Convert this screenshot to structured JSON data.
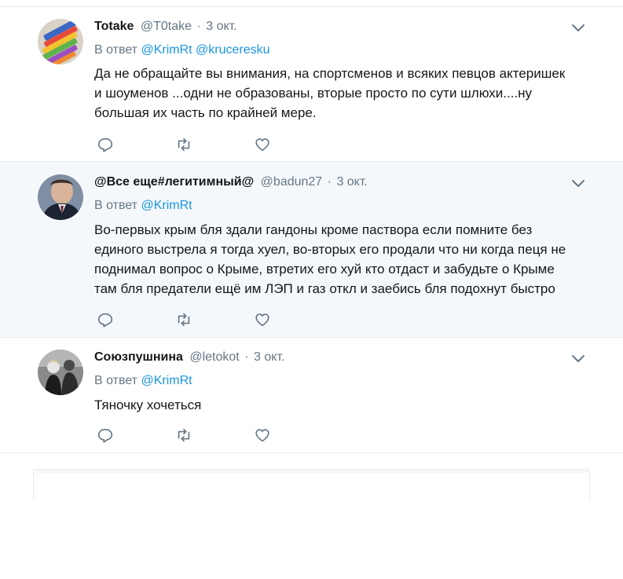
{
  "colors": {
    "link": "#1b95e0",
    "muted": "#657786",
    "text": "#14171a",
    "highlight_bg": "#f5f8fa",
    "divider": "#e6ecf0"
  },
  "tweets": [
    {
      "name": "Totake",
      "handle": "@T0take",
      "separator": "·",
      "date": "3 окт.",
      "reply_prefix": "В ответ",
      "mentions": [
        "@KrimRt",
        "@kruceresku"
      ],
      "text_lines": [
        "Да не обращайте вы внимания, на спортсменов и всяких певцов актеришек",
        "и шоуменов ...одни не образованы, вторые просто по сути шлюхи....ну",
        "большая их часть по крайней мере."
      ],
      "avatar_icon": "colored-pencils-avatar"
    },
    {
      "name": "@Все еще#легитимный@",
      "handle": "@badun27",
      "separator": "·",
      "date": "3 окт.",
      "reply_prefix": "В ответ",
      "mentions": [
        "@KrimRt"
      ],
      "text_lines": [
        "Во-первых крым бля здали гандоны кроме пастворa если помните без",
        "единого выстрела я тогда хуел, во-вторых его продали что ни когда пеця не",
        "поднимал вопрос о Крыме, втретих его хуй кто отдаст и забудьте о Крыме",
        "там бля предатели ещё им ЛЭП и газ откл и заебись бля подохнут быстро"
      ],
      "avatar_icon": "man-portrait-avatar"
    },
    {
      "name": "Союзпушнина",
      "handle": "@letokot",
      "separator": "·",
      "date": "3 окт.",
      "reply_prefix": "В ответ",
      "mentions": [
        "@KrimRt"
      ],
      "text_lines": [
        "Тяночку хочеться"
      ],
      "avatar_icon": "bw-photo-avatar"
    }
  ]
}
